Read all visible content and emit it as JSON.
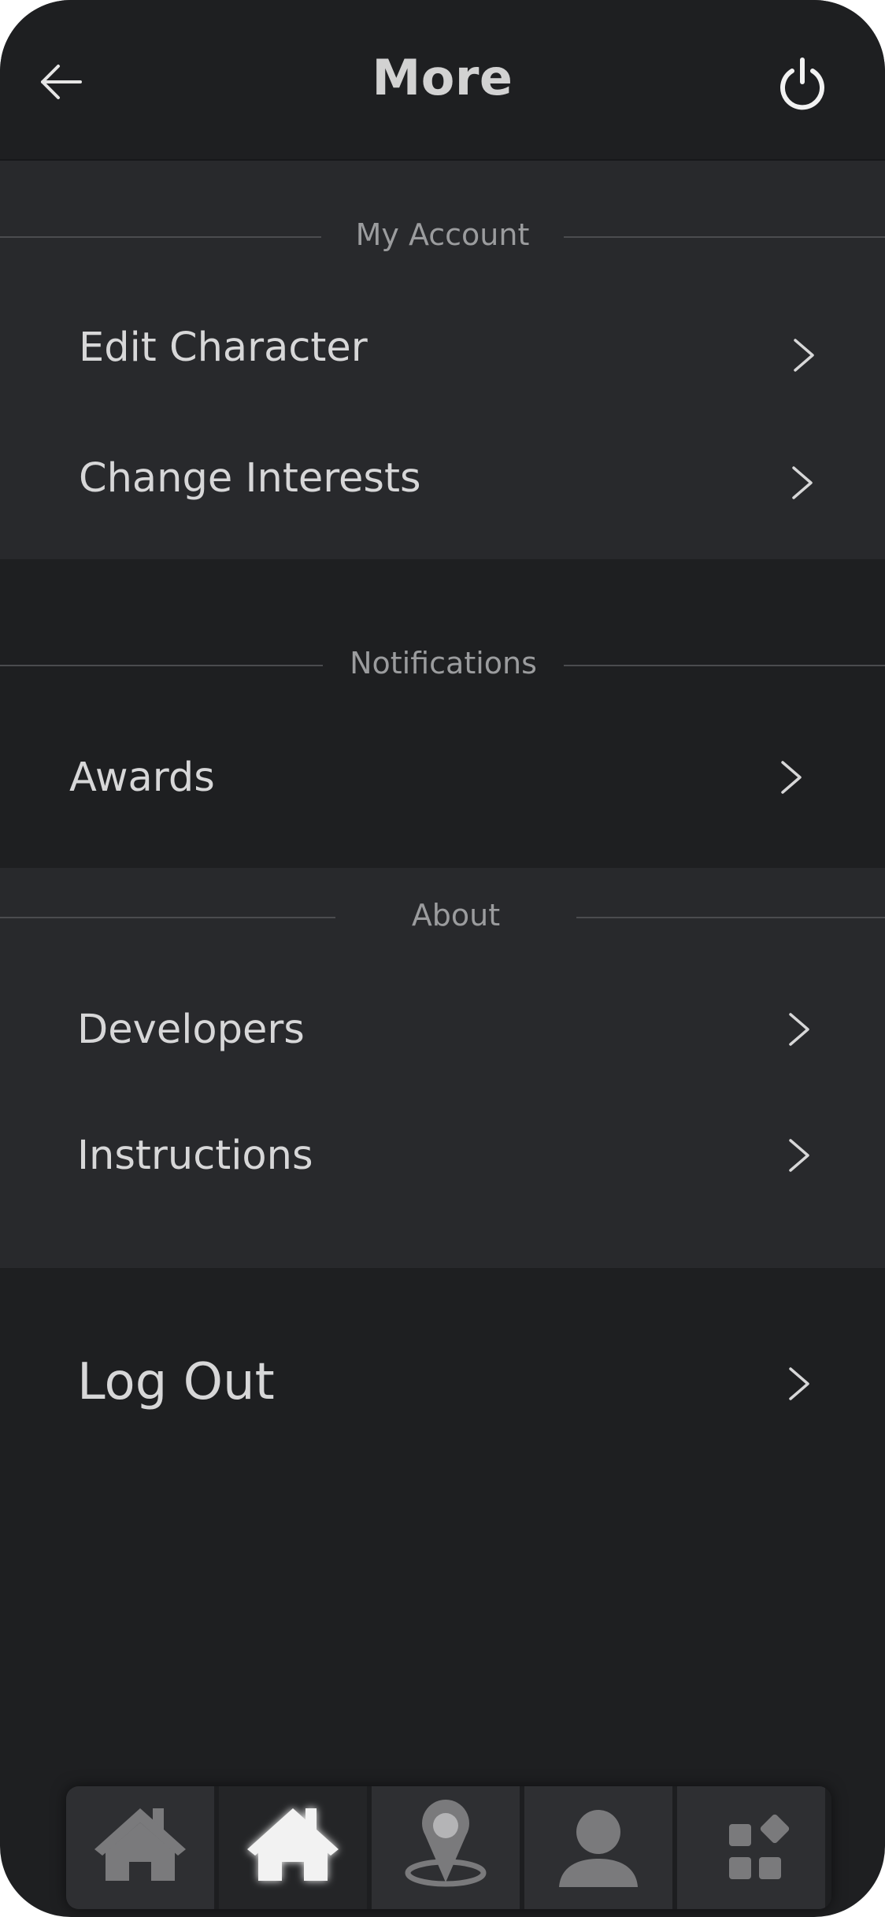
{
  "header": {
    "title": "More",
    "back_icon": "arrow-left-icon",
    "power_icon": "power-icon"
  },
  "sections": {
    "my_account": {
      "label": "My Account",
      "items": [
        "Edit Character",
        "Change Interests"
      ]
    },
    "notifications": {
      "label": "Notifications",
      "items": [
        "Awards"
      ]
    },
    "about": {
      "label": "About",
      "items": [
        "Developers",
        "Instructions"
      ]
    }
  },
  "logout": {
    "label": "Log Out"
  },
  "tabbar": {
    "active_index": 1,
    "tabs": [
      {
        "icon": "home-icon"
      },
      {
        "icon": "home-icon"
      },
      {
        "icon": "map-pin-icon"
      },
      {
        "icon": "profile-icon"
      },
      {
        "icon": "apps-grid-icon"
      }
    ]
  },
  "colors": {
    "background": "#1e1f21",
    "panel": "#28292c",
    "text": "#d7d7d8",
    "section_label": "#9b9c9e",
    "icon_gray": "#7a7a7c",
    "icon_active": "#f2f2f2"
  }
}
